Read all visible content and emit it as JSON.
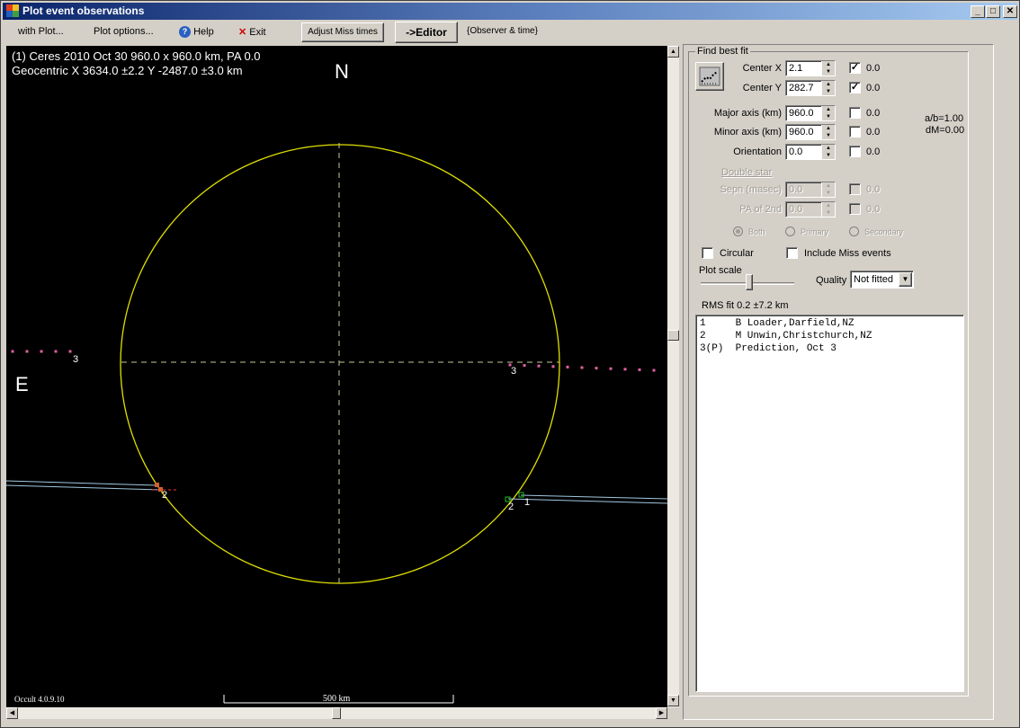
{
  "window": {
    "title": "Plot event observations",
    "controls": [
      "minimize",
      "maximize",
      "close"
    ]
  },
  "menu": {
    "with_plot": "with Plot...",
    "plot_options": "Plot options...",
    "help": "Help",
    "exit": "Exit",
    "adjust_miss": "Adjust Miss times",
    "editor": "->Editor",
    "observer_time": "{Observer & time}"
  },
  "plot": {
    "header_line1": "(1) Ceres  2010 Oct 30   960.0 x 960.0 km, PA 0.0",
    "header_line2": "Geocentric X  3634.0 ±2.2  Y -2487.0 ±3.0 km",
    "north": "N",
    "east": "E",
    "version": "Occult 4.0.9.10",
    "scale_label": "500 km",
    "chord_labels": {
      "left_prediction": "3",
      "right_prediction": "3",
      "left_observer": "2",
      "right_observer2": "2",
      "right_observer1": "1"
    },
    "colors": {
      "limb": "#e0e000",
      "axes": "#c8c89a",
      "prediction": "#e060a0",
      "chord": "#a0c8e0",
      "disappear": "#ff6060",
      "reappear": "#20c020"
    }
  },
  "fit_panel": {
    "group_label": "Find best fit",
    "rows": [
      {
        "label": "Center X",
        "value": "2.1",
        "checked": true,
        "result": "0.0"
      },
      {
        "label": "Center Y",
        "value": "282.7",
        "checked": true,
        "result": "0.0"
      },
      {
        "label": "Major axis (km)",
        "value": "960.0",
        "checked": false,
        "result": "0.0"
      },
      {
        "label": "Minor axis (km)",
        "value": "960.0",
        "checked": false,
        "result": "0.0"
      },
      {
        "label": "Orientation",
        "value": "0.0",
        "checked": false,
        "result": "0.0"
      }
    ],
    "ratio": "a/b=1.00",
    "dm": "dM=0.00",
    "double_star": {
      "label": "Double star",
      "rows": [
        {
          "label": "Sepn (masec)",
          "value": "0.0",
          "result": "0.0"
        },
        {
          "label": "PA of 2nd",
          "value": "0.0",
          "result": "0.0"
        }
      ],
      "radios": [
        "Both",
        "Primary",
        "Secondary"
      ],
      "selected": "Both"
    },
    "circular": "Circular",
    "include_miss": "Include Miss events",
    "plot_scale": "Plot scale",
    "quality_label": "Quality",
    "quality_value": "Not fitted",
    "rms": "RMS fit 0.2 ±7.2 km",
    "observers": [
      "1     B Loader,Darfield,NZ",
      "2     M Unwin,Christchurch,NZ",
      "3(P)  Prediction, Oct 3"
    ]
  }
}
